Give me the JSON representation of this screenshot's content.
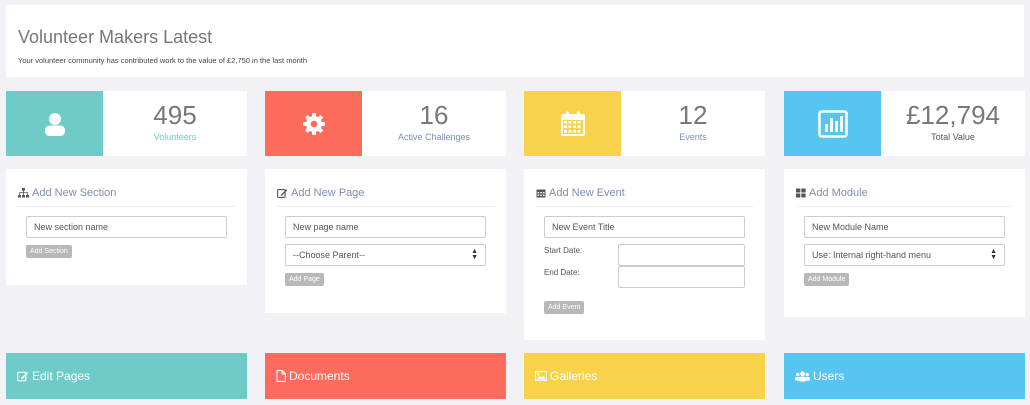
{
  "header": {
    "title": "Volunteer Makers Latest",
    "subtitle": "Your volunteer community has contributed work to the value of £2,750 in the last month"
  },
  "stats": [
    {
      "value": "495",
      "label": "Volunteers",
      "icon": "user-icon",
      "color": "#6ecbc7"
    },
    {
      "value": "16",
      "label": "Active Challenges",
      "icon": "gear-icon",
      "color": "#fd6b5d"
    },
    {
      "value": "12",
      "label": "Events",
      "icon": "calendar-icon",
      "color": "#f7d24a"
    },
    {
      "value": "£12,794",
      "label": "Total Value",
      "icon": "bar-chart-icon",
      "color": "#56c5f1"
    }
  ],
  "panels": {
    "section": {
      "title": "Add New Section",
      "input": "New section name",
      "button": "Add Section"
    },
    "page": {
      "title": "Add New Page",
      "input": "New page name",
      "select": "--Choose Parent--",
      "button": "Add Page"
    },
    "event": {
      "title": "Add New Event",
      "input": "New Event Title",
      "start_label": "Start Date:",
      "end_label": "End Date:",
      "button": "Add Event"
    },
    "module": {
      "title": "Add Module",
      "input": "New Module Name",
      "select": "Use: Internal right-hand menu",
      "button": "Add Module"
    }
  },
  "tiles": [
    {
      "label": "Edit Pages",
      "icon": "edit-icon",
      "color": "#6ecbc7"
    },
    {
      "label": "Documents",
      "icon": "document-icon",
      "color": "#fd6b5d"
    },
    {
      "label": "Galleries",
      "icon": "image-icon",
      "color": "#f7d24a"
    },
    {
      "label": "Users",
      "icon": "users-icon",
      "color": "#56c5f1"
    }
  ]
}
